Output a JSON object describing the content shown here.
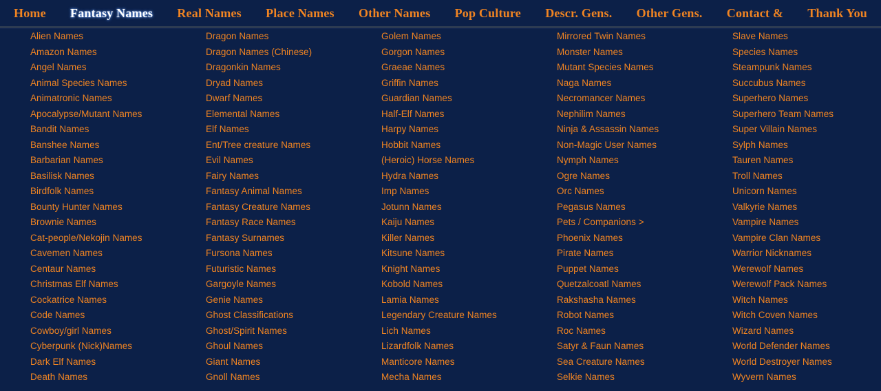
{
  "colors": {
    "background": "#0c2048",
    "link": "#f08422",
    "nav_active": "#ffffff",
    "divider": "#2d3b52"
  },
  "topnav": {
    "items": [
      {
        "label": "Home",
        "active": false
      },
      {
        "label": "Fantasy Names",
        "active": true
      },
      {
        "label": "Real Names",
        "active": false
      },
      {
        "label": "Place Names",
        "active": false
      },
      {
        "label": "Other Names",
        "active": false
      },
      {
        "label": "Pop Culture",
        "active": false
      },
      {
        "label": "Descr. Gens.",
        "active": false
      },
      {
        "label": "Other Gens.",
        "active": false
      },
      {
        "label": "Contact &",
        "active": false
      },
      {
        "label": "Thank You",
        "active": false
      }
    ]
  },
  "columns": [
    {
      "items": [
        "Alien Names",
        "Amazon Names",
        "Angel Names",
        "Animal Species Names",
        "Animatronic Names",
        "Apocalypse/Mutant Names",
        "Bandit Names",
        "Banshee Names",
        "Barbarian Names",
        "Basilisk Names",
        "Birdfolk Names",
        "Bounty Hunter Names",
        "Brownie Names",
        "Cat-people/Nekojin Names",
        "Cavemen Names",
        "Centaur Names",
        "Christmas Elf Names",
        "Cockatrice Names",
        "Code Names",
        "Cowboy/girl Names",
        "Cyberpunk (Nick)Names",
        "Dark Elf Names",
        "Death Names"
      ]
    },
    {
      "items": [
        "Dragon Names",
        "Dragon Names (Chinese)",
        "Dragonkin Names",
        "Dryad Names",
        "Dwarf Names",
        "Elemental Names",
        "Elf Names",
        "Ent/Tree creature Names",
        "Evil Names",
        "Fairy Names",
        "Fantasy Animal Names",
        "Fantasy Creature Names",
        "Fantasy Race Names",
        "Fantasy Surnames",
        "Fursona Names",
        "Futuristic Names",
        "Gargoyle Names",
        "Genie Names",
        "Ghost Classifications",
        "Ghost/Spirit Names",
        "Ghoul Names",
        "Giant Names",
        "Gnoll Names"
      ]
    },
    {
      "items": [
        "Golem Names",
        "Gorgon Names",
        "Graeae Names",
        "Griffin Names",
        "Guardian Names",
        "Half-Elf Names",
        "Harpy Names",
        "Hobbit Names",
        "(Heroic) Horse Names",
        "Hydra Names",
        "Imp Names",
        "Jotunn Names",
        "Kaiju Names",
        "Killer Names",
        "Kitsune Names",
        "Knight Names",
        "Kobold Names",
        "Lamia Names",
        "Legendary Creature Names",
        "Lich Names",
        "Lizardfolk Names",
        "Manticore Names",
        "Mecha Names"
      ]
    },
    {
      "items": [
        "Mirrored Twin Names",
        "Monster Names",
        "Mutant Species Names",
        "Naga Names",
        "Necromancer Names",
        "Nephilim Names",
        "Ninja & Assassin Names",
        "Non-Magic User Names",
        "Nymph Names",
        "Ogre Names",
        "Orc Names",
        "Pegasus Names",
        "Pets / Companions >",
        "Phoenix Names",
        "Pirate Names",
        "Puppet Names",
        "Quetzalcoatl Names",
        "Rakshasha Names",
        "Robot Names",
        "Roc Names",
        "Satyr & Faun Names",
        "Sea Creature Names",
        "Selkie Names"
      ]
    },
    {
      "items": [
        "Slave Names",
        "Species Names",
        "Steampunk Names",
        "Succubus Names",
        "Superhero Names",
        "Superhero Team Names",
        "Super Villain Names",
        "Sylph Names",
        "Tauren Names",
        "Troll Names",
        "Unicorn Names",
        "Valkyrie Names",
        "Vampire Names",
        "Vampire Clan Names",
        "Warrior Nicknames",
        "Werewolf Names",
        "Werewolf Pack Names",
        "Witch Names",
        "Witch Coven Names",
        "Wizard Names",
        "World Defender Names",
        "World Destroyer Names",
        "Wyvern Names"
      ]
    }
  ]
}
